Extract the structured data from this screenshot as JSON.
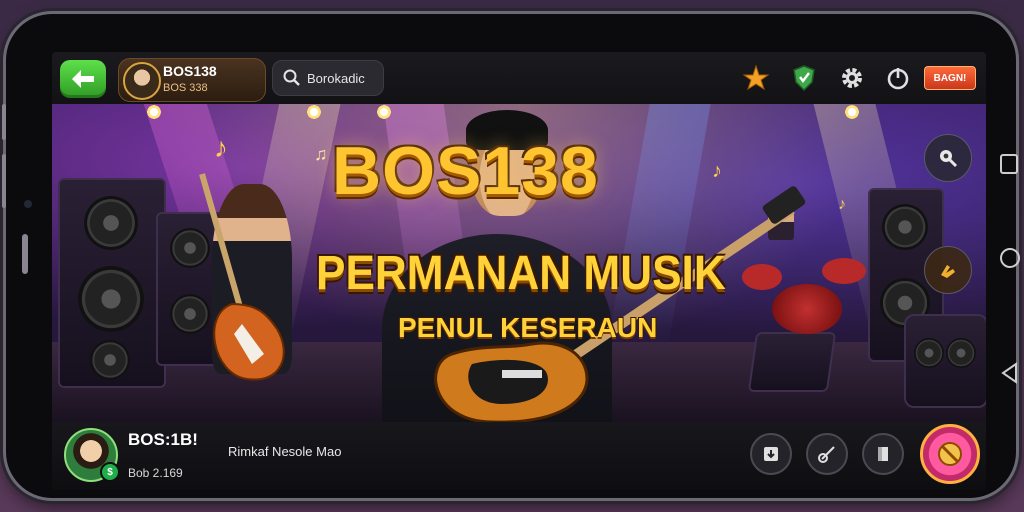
{
  "header": {
    "profile_name": "BOS138",
    "profile_score": "BOS 338",
    "search_text": "Borokadic",
    "badge_label": "BAGN!"
  },
  "banner": {
    "title": "BOS138",
    "subtitle": "PERMANAN MUSIK",
    "tagline": "PENUL KESERAUN"
  },
  "footer": {
    "player_name": "BOS:1B!",
    "message": "Rimkaf Nesole Mao",
    "score": "Bob 2.169",
    "coin_symbol": "$"
  },
  "icons": {
    "back": "arrow-left-icon",
    "search": "search-icon",
    "star": "star-icon",
    "shield": "shield-icon",
    "settings": "gear-icon",
    "power": "power-icon",
    "zoom": "zoom-icon",
    "guitar_hand": "hand-icon",
    "download": "download-icon",
    "guitar": "guitar-icon",
    "card": "card-icon",
    "no": "no-entry-icon"
  },
  "colors": {
    "title_gold": "#ffc531",
    "back_green": "#3fbf30",
    "badge_orange": "#e2492a",
    "big_button_pink": "#ff5aa0"
  }
}
